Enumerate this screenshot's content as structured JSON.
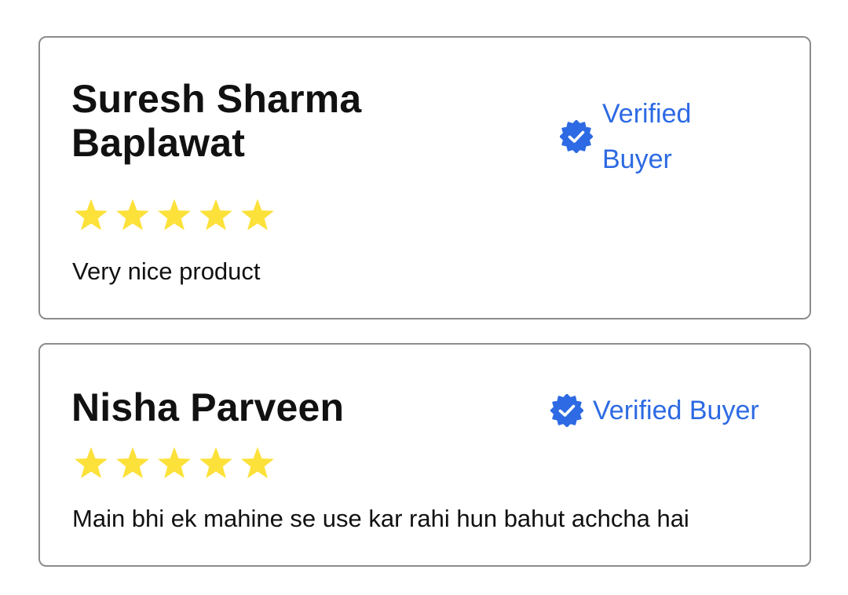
{
  "colors": {
    "verified": "#2d6ae3",
    "star": "#fce13a",
    "border": "#8c8c8c",
    "text": "#111111"
  },
  "icons": {
    "verified": "verified-badge-icon",
    "rating": "star-icon"
  },
  "reviews": [
    {
      "name": "Suresh Sharma Baplawat",
      "verified_label": "Verified Buyer",
      "rating": 5,
      "max_rating": 5,
      "text": "Very nice product"
    },
    {
      "name": "Nisha Parveen",
      "verified_label": "Verified Buyer",
      "rating": 5,
      "max_rating": 5,
      "text": "Main bhi ek mahine se use kar rahi hun bahut achcha hai"
    }
  ]
}
